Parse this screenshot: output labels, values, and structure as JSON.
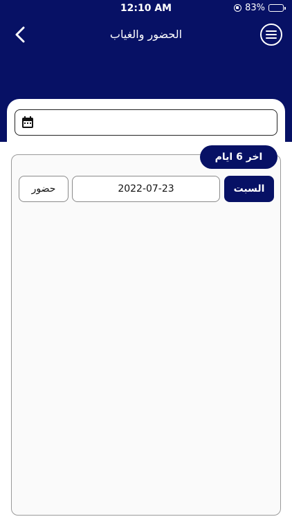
{
  "status_bar": {
    "time": "12:10 AM",
    "battery": "83%"
  },
  "header": {
    "title": "الحضور والغياب",
    "back_icon": "chevron-left-icon",
    "menu_icon": "menu-circle-icon",
    "background_color": "#071165"
  },
  "date_picker": {
    "icon": "calendar-icon",
    "value": ""
  },
  "attendance": {
    "period_label": "اخر 6 ايام",
    "records": [
      {
        "day": "السبت",
        "date": "2022-07-23",
        "status": "حضور"
      }
    ]
  }
}
